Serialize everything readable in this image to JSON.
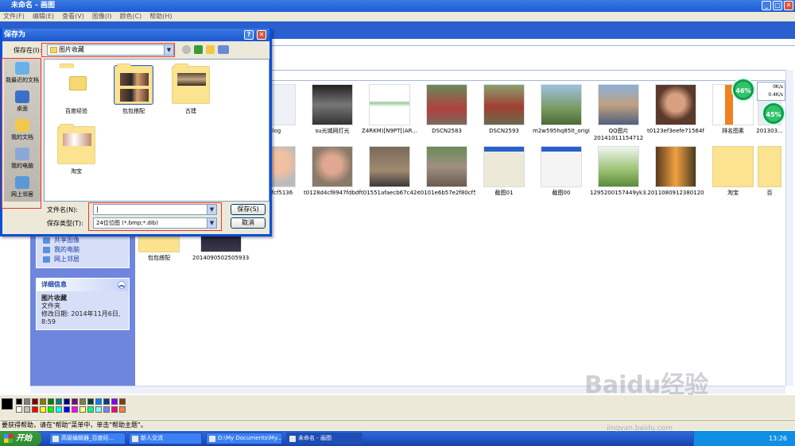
{
  "paint": {
    "title": "未命名 - 画图",
    "menu": [
      "文件(F)",
      "编辑(E)",
      "查看(V)",
      "图像(I)",
      "颜色(C)",
      "帮助(H)"
    ],
    "status": "要获得帮助，请在\"帮助\"菜单中，单击\"帮助主题\"。"
  },
  "explorer": {
    "panel_links": [
      "共享图像",
      "我的电脑",
      "网上邻居"
    ],
    "details": {
      "header": "详细信息",
      "name": "图片收藏",
      "type": "文件夹",
      "modified": "修改日期: 2014年11月6日, 8:59"
    },
    "row1": [
      "clog",
      "su光城网灯光",
      "Z4RKM)[N9PT[(AR...",
      "DSCN2583",
      "DSCN2593",
      "m2w595hq85lt_origi...",
      "QQ图片 20141011154712",
      "t0123ef3eefe71564fa",
      "排名图素",
      "201303..."
    ],
    "row2": [
      "d04bfcf5136",
      "t0128d4cf8947fdbdf2",
      "t01551afaecb67c42eb",
      "t0101e6b57e2f80cf5c",
      "截图01",
      "截图00",
      "1295200157449yk3...",
      "2011080912380120",
      "淘宝",
      "百"
    ],
    "row3": [
      "包包搭配",
      "20140905025059338"
    ]
  },
  "dialog": {
    "title": "保存为",
    "help": "?",
    "close": "✕",
    "save_in_label": "保存在(I):",
    "save_in_value": "图片收藏",
    "places": [
      "我最近的文档",
      "桌面",
      "我的文档",
      "我的电脑",
      "网上邻居"
    ],
    "folders": [
      "百度经验",
      "包包搭配",
      "古建",
      "淘宝"
    ],
    "filename_label": "文件名(N):",
    "filename_value": "|",
    "filetype_label": "保存类型(T):",
    "filetype_value": "24位位图 (*.bmp;*.dib)",
    "save_button": "保存(S)",
    "cancel_button": "取消"
  },
  "gauges": {
    "left": "46%",
    "right": "45%"
  },
  "speed": {
    "up": "0K/s",
    "down": "0.4K/s"
  },
  "taskbar": {
    "start": "开始",
    "tasks": [
      "高级编辑器_百度经...",
      "新人交流",
      "D:\\My Documents\\My...",
      "未命名 - 画图"
    ],
    "clock": "13:26"
  },
  "watermark": {
    "brand": "Baidu经验",
    "url": "jingyan.baidu.com"
  },
  "colors": {
    "xp_blue": "#0a4fd6",
    "annotation_red": "#e33333",
    "panel_blue": "#6f86de"
  }
}
